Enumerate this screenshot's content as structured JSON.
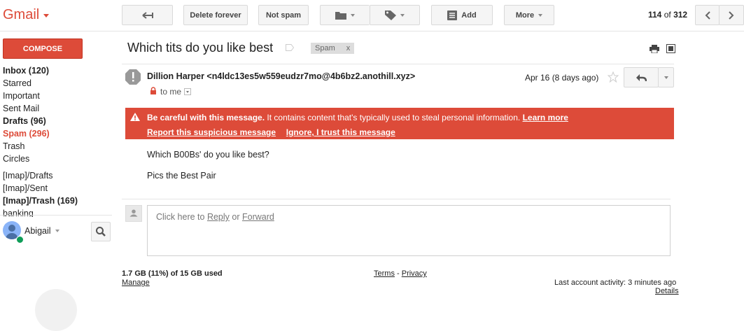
{
  "app": {
    "logo": "Gmail"
  },
  "toolbar": {
    "delete_forever": "Delete forever",
    "not_spam": "Not spam",
    "add": "Add",
    "more": "More",
    "pager_range": "114",
    "pager_of": "of",
    "pager_total": "312"
  },
  "sidebar": {
    "compose": "COMPOSE",
    "items": [
      {
        "label": "Inbox (120)",
        "style": "bold"
      },
      {
        "label": "Starred",
        "style": "normal"
      },
      {
        "label": "Important",
        "style": "normal"
      },
      {
        "label": "Sent Mail",
        "style": "normal"
      },
      {
        "label": "Drafts (96)",
        "style": "bold"
      },
      {
        "label": "Spam (296)",
        "style": "red"
      },
      {
        "label": "Trash",
        "style": "normal"
      },
      {
        "label": "Circles",
        "style": "normal"
      },
      {
        "label": "[Imap]/Drafts",
        "style": "normal"
      },
      {
        "label": "[Imap]/Sent",
        "style": "normal"
      },
      {
        "label": "[Imap]/Trash (169)",
        "style": "bold"
      },
      {
        "label": "banking",
        "style": "normal"
      }
    ],
    "user_name": "Abigail"
  },
  "message": {
    "subject": "Which tits do you like best",
    "label_chip": "Spam",
    "label_chip_remove": "x",
    "sender": "Dillion Harper <n4ldc13es5w559eudzr7mo@4b6bz2.anothill.xyz>",
    "to": "to me",
    "date": "Apr 16 (8 days ago)",
    "warning": {
      "title": "Be careful with this message.",
      "text": " It contains content that's typically used to steal personal information. ",
      "learn_more": "Learn more",
      "report": "Report this suspicious message",
      "ignore": "Ignore, I trust this message"
    },
    "body": [
      "Which B00Bs' do you like best?",
      "Pics the Best Pair"
    ],
    "reply_prompt_prefix": "Click here to ",
    "reply_link": "Reply",
    "reply_or": " or ",
    "forward_link": "Forward"
  },
  "footer": {
    "storage": "1.7 GB (11%) of 15 GB used",
    "manage": "Manage",
    "terms": "Terms",
    "separator": " - ",
    "privacy": "Privacy",
    "activity": "Last account activity: 3 minutes ago",
    "details": "Details"
  },
  "colors": {
    "brand_red": "#dd4b39",
    "button_bg": "#f5f5f5"
  }
}
